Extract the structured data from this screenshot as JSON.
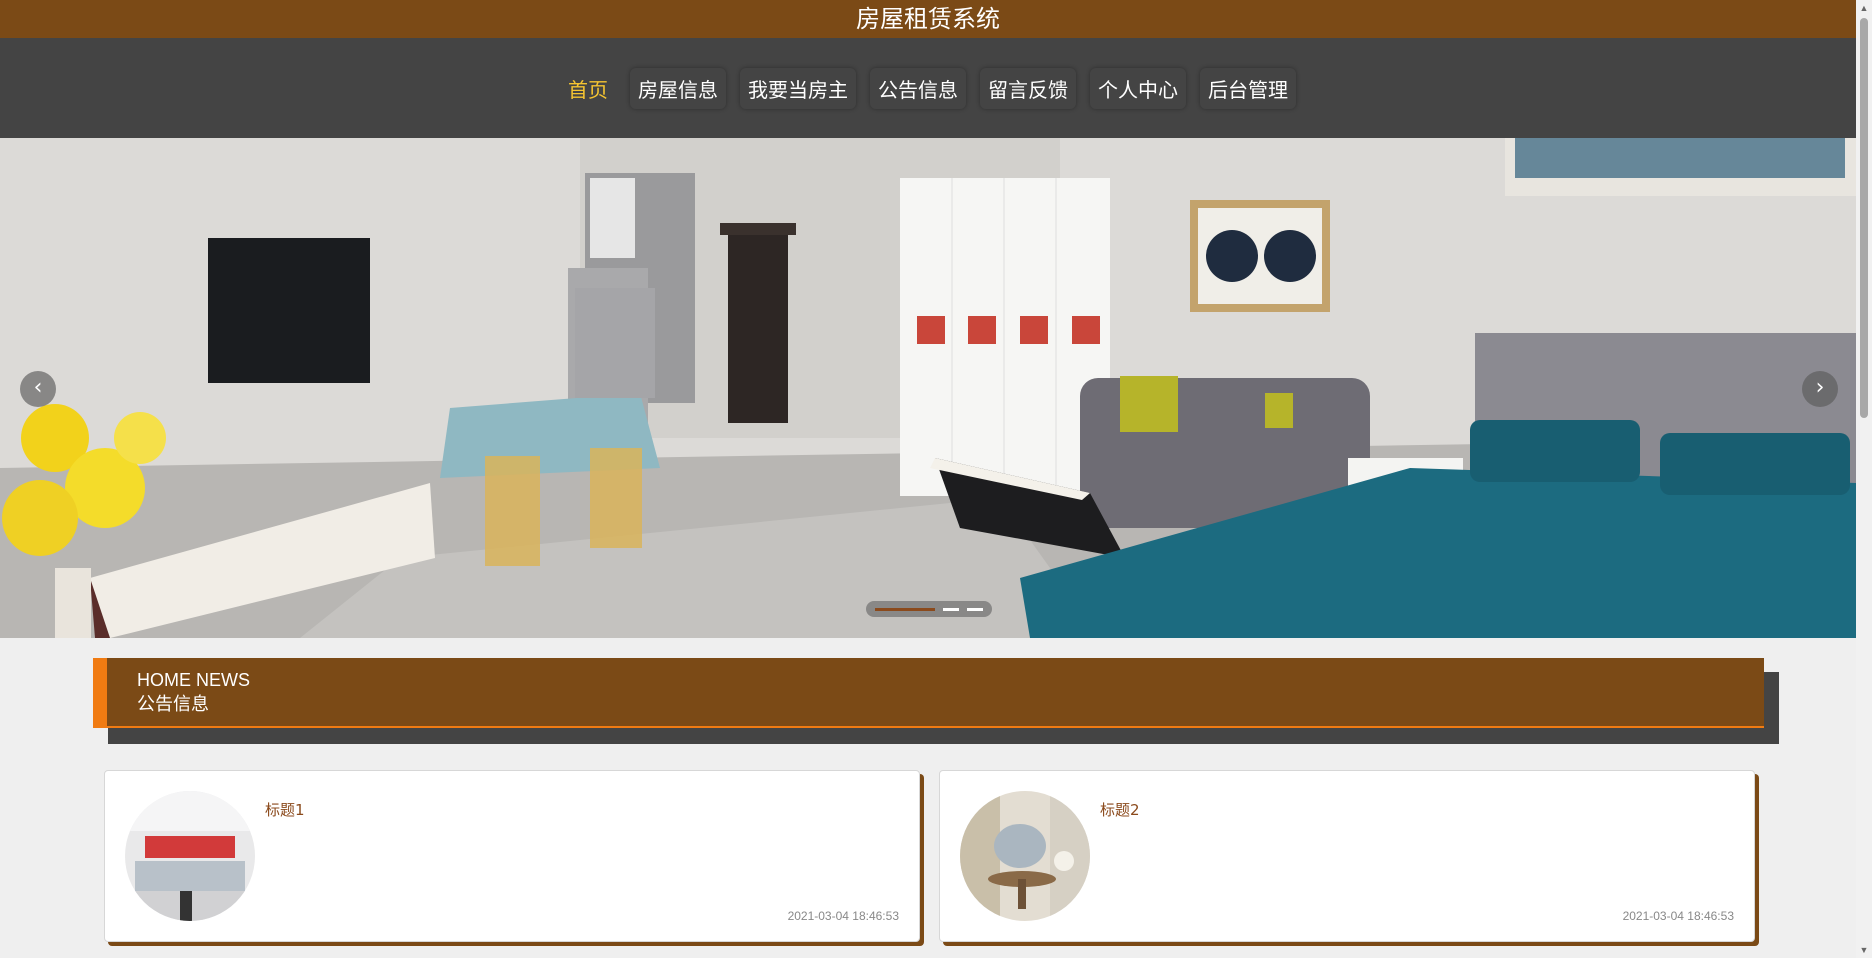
{
  "header": {
    "title": "房屋租赁系统"
  },
  "nav": {
    "items": [
      {
        "label": "首页",
        "active": true
      },
      {
        "label": "房屋信息",
        "active": false
      },
      {
        "label": "我要当房主",
        "active": false
      },
      {
        "label": "公告信息",
        "active": false
      },
      {
        "label": "留言反馈",
        "active": false
      },
      {
        "label": "个人中心",
        "active": false
      },
      {
        "label": "后台管理",
        "active": false
      }
    ],
    "active_color": "#f5c431"
  },
  "carousel": {
    "prev_icon": "chevron-left-icon",
    "next_icon": "chevron-right-icon",
    "prev_glyph": "‹",
    "next_glyph": "›",
    "slide_count": 3,
    "active_slide": 1
  },
  "section": {
    "title_en": "HOME NEWS",
    "title_cn": "公告信息"
  },
  "news": [
    {
      "title": "标题1",
      "time": "2021-03-04 18:46:53"
    },
    {
      "title": "标题2",
      "time": "2021-03-04 18:46:53"
    }
  ],
  "colors": {
    "brand_brown": "#7b4a16",
    "nav_bg": "#444444",
    "accent_orange": "#f07b12",
    "page_bg": "#efefef"
  },
  "scrollbar": {
    "up_glyph": "▲",
    "down_glyph": "▼"
  }
}
